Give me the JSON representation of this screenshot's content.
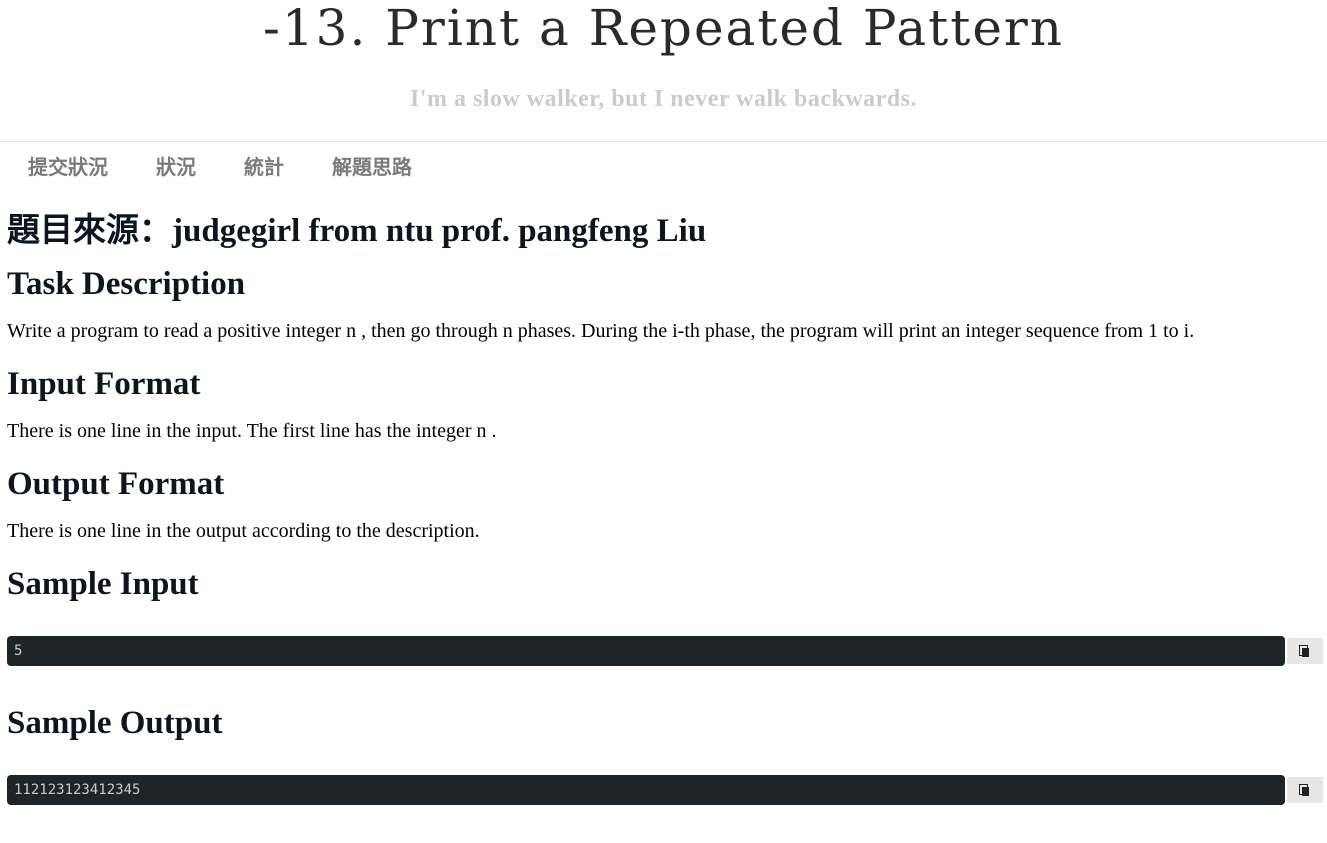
{
  "header": {
    "title": "-13. Print a Repeated Pattern",
    "subtitle": "I'm a slow walker, but I never walk backwards."
  },
  "nav": {
    "items": [
      {
        "label": "提交狀況"
      },
      {
        "label": "狀況"
      },
      {
        "label": "統計"
      },
      {
        "label": "解題思路"
      }
    ]
  },
  "problem": {
    "source_heading": "題目來源：judgegirl from ntu prof. pangfeng Liu",
    "task_heading": "Task Description",
    "task_text": "Write a program to read a positive integer n , then go through n  phases. During the i-th phase, the program will print an integer sequence from 1 to i.",
    "input_heading": "Input Format",
    "input_text": "There is one line in the input. The first line has the integer n .",
    "output_heading": "Output Format",
    "output_text": "There is one line in the output according to the description.",
    "sample_input_heading": "Sample Input",
    "sample_input_code": "5",
    "sample_output_heading": "Sample Output",
    "sample_output_code": "112123123412345"
  },
  "icons": {
    "copy": "copy-icon"
  }
}
